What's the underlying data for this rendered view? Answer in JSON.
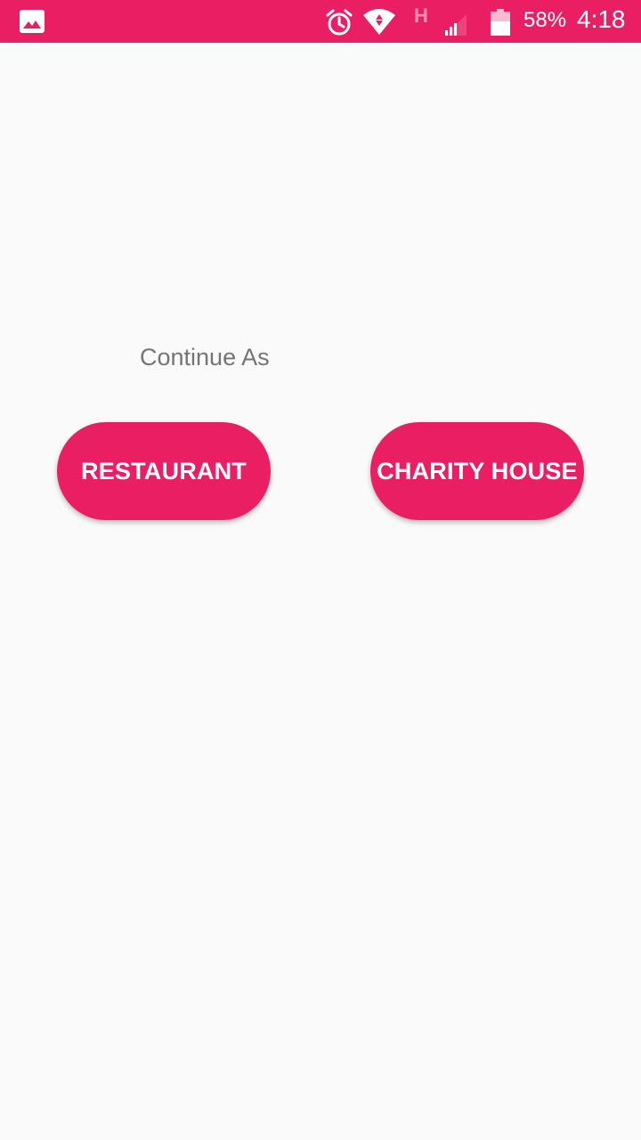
{
  "status_bar": {
    "network_type": "H",
    "battery_percent": "58%",
    "time": "4:18",
    "background_color": "#e91e63",
    "icons": [
      "gallery-icon",
      "alarm-icon",
      "wifi-icon",
      "signal-icon",
      "battery-icon"
    ],
    "battery_level": 0.58
  },
  "main": {
    "prompt": "Continue As",
    "buttons": {
      "restaurant_label": "RESTAURANT",
      "charity_label": "CHARITY HOUSE"
    },
    "accent_color": "#e91e63",
    "prompt_color": "#757575"
  }
}
